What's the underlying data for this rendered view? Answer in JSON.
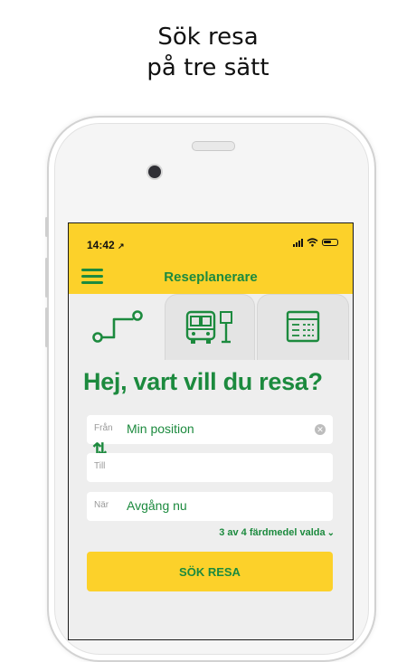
{
  "caption": {
    "line1": "Sök resa",
    "line2": "på tre sätt"
  },
  "status": {
    "time": "14:42",
    "location_glyph": "↗"
  },
  "header": {
    "title": "Reseplanerare",
    "menu_icon": "hamburger-icon"
  },
  "tabs": [
    {
      "icon": "route-icon",
      "active": true
    },
    {
      "icon": "bus-stop-icon",
      "active": false
    },
    {
      "icon": "timetable-icon",
      "active": false
    }
  ],
  "main": {
    "heading": "Hej, vart vill du resa?",
    "from": {
      "label": "Från",
      "value": "Min position"
    },
    "to": {
      "label": "Till",
      "value": ""
    },
    "when": {
      "label": "När",
      "value": "Avgång nu"
    },
    "modes_text": "3 av 4 färdmedel valda",
    "search_label": "SÖK RESA"
  },
  "colors": {
    "accent_yellow": "#fcd12a",
    "brand_green": "#1c8a3e"
  }
}
